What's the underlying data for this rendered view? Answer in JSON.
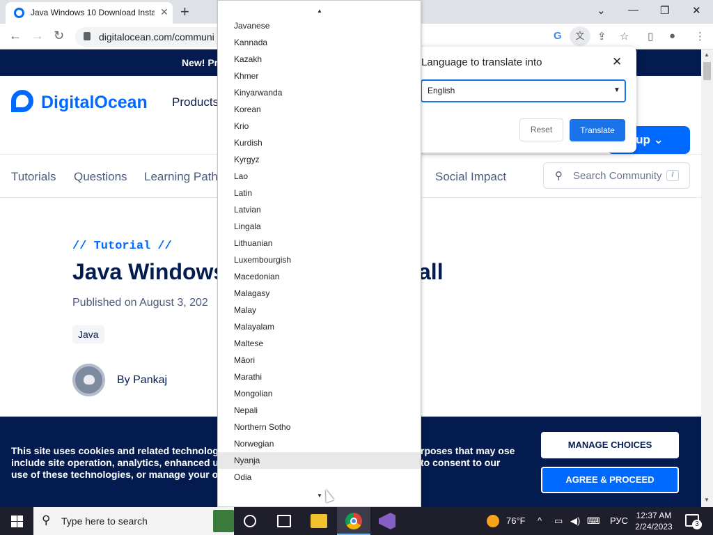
{
  "browser": {
    "tab_title": "Java Windows 10 Download Insta",
    "tab_close": "✕",
    "new_tab": "+",
    "url": "digitalocean.com/communi",
    "window_controls": {
      "tabs_menu": "⌄",
      "minimize": "—",
      "restore": "❐",
      "close": "✕"
    }
  },
  "site": {
    "banner_text": "New! Pr",
    "logo_text": "DigitalOcean",
    "products_nav": "Products",
    "signup_label": "n up ⌄",
    "subnav": [
      "Tutorials",
      "Questions",
      "Learning Path",
      "Social Impact"
    ],
    "search_placeholder": "Search Community",
    "search_shortcut": "/"
  },
  "article": {
    "eyebrow": "// Tutorial //",
    "title_start": "Java Windows",
    "title_end": "all",
    "published": "Published on August 3, 202",
    "tag": "Java",
    "author": "By Pankaj"
  },
  "cookie_banner": {
    "text_left": "This site uses cookies and related technolog include site operation, analytics, enhanced u use of these technologies, or manage your o",
    "text_right": "rposes that may ose to consent to our",
    "manage_label": "MANAGE CHOICES",
    "agree_label": "AGREE & PROCEED"
  },
  "translate_popup": {
    "heading": "Language to translate into",
    "close": "✕",
    "selected_language": "English",
    "reset_label": "Reset",
    "translate_label": "Translate"
  },
  "language_list": {
    "items": [
      "Javanese",
      "Kannada",
      "Kazakh",
      "Khmer",
      "Kinyarwanda",
      "Korean",
      "Krio",
      "Kurdish",
      "Kyrgyz",
      "Lao",
      "Latin",
      "Latvian",
      "Lingala",
      "Lithuanian",
      "Luxembourgish",
      "Macedonian",
      "Malagasy",
      "Malay",
      "Malayalam",
      "Maltese",
      "Māori",
      "Marathi",
      "Mongolian",
      "Nepali",
      "Northern Sotho",
      "Norwegian",
      "Nyanja",
      "Odia"
    ],
    "hovered": "Nyanja"
  },
  "taskbar": {
    "search_placeholder": "Type here to search",
    "weather": "76°F",
    "language": "РУС",
    "time": "12:37 AM",
    "date": "2/24/2023",
    "notification_count": "3"
  },
  "colors": {
    "brand_blue": "#0069ff",
    "navy": "#031b4e",
    "chrome_blue": "#1a73e8"
  }
}
